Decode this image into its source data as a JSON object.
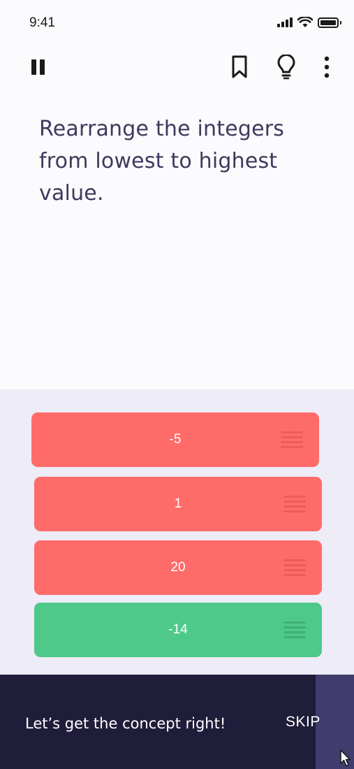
{
  "status_bar": {
    "time": "9:41"
  },
  "toolbar": {
    "pause_icon": "pause-icon",
    "bookmark_icon": "bookmark-icon",
    "hint_icon": "lightbulb-icon",
    "more_icon": "more-vertical-icon"
  },
  "question": {
    "text": "Rearrange the integers from lowest to highest value."
  },
  "answers": [
    {
      "label": "-5",
      "state": "incorrect",
      "color": "#ff6b69"
    },
    {
      "label": "1",
      "state": "incorrect",
      "color": "#ff6b69"
    },
    {
      "label": "20",
      "state": "incorrect",
      "color": "#ff6b69"
    },
    {
      "label": "-14",
      "state": "correct",
      "color": "#4fc98a"
    }
  ],
  "feedback": {
    "message": "Let’s get the concept right!",
    "skip_label": "SKIP"
  },
  "colors": {
    "background": "#fbfafd",
    "answer_area": "#edecf7",
    "text_primary": "#3d3a5c",
    "feedback_bar": "#1f1d3a",
    "skip_highlight": "#413c6e"
  }
}
